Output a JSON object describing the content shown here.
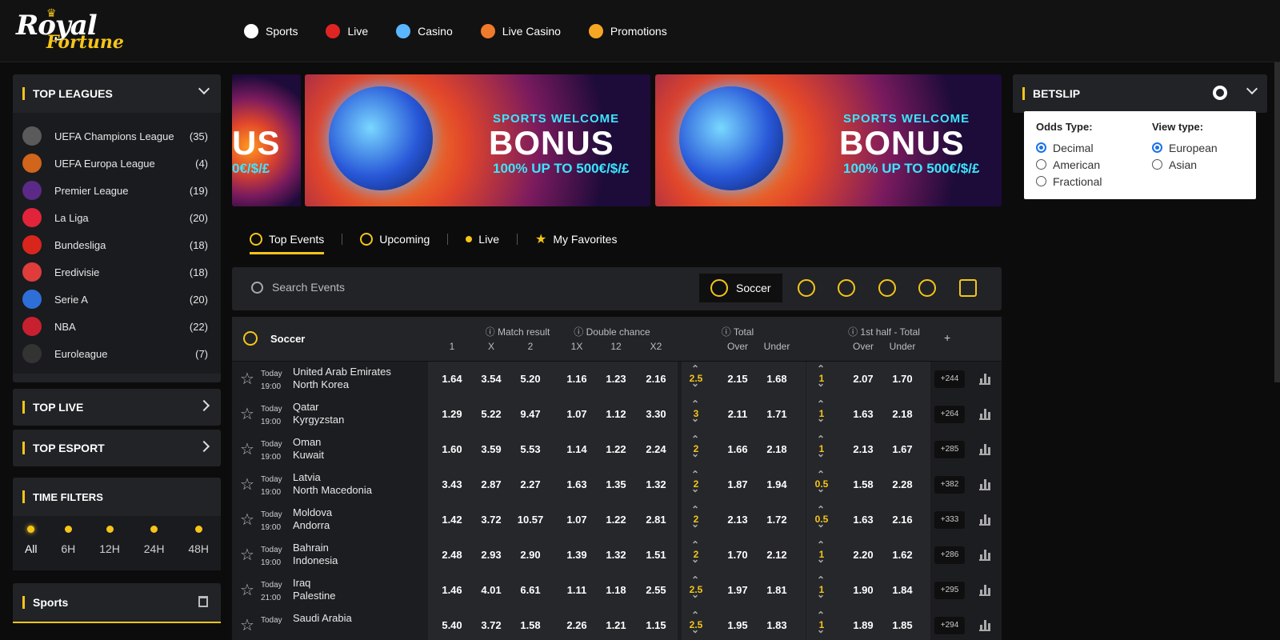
{
  "brand": {
    "line1": "Royal",
    "line2": "Fortune"
  },
  "nav": [
    {
      "label": "Sports",
      "icon": "soccer-ball-icon",
      "color": "#ffffff"
    },
    {
      "label": "Live",
      "icon": "live-play-icon",
      "color": "#e02424"
    },
    {
      "label": "Casino",
      "icon": "diamond-icon",
      "color": "#5ab7ff"
    },
    {
      "label": "Live Casino",
      "icon": "roulette-icon",
      "color": "#f07a2c"
    },
    {
      "label": "Promotions",
      "icon": "gift-icon",
      "color": "#f5a623"
    }
  ],
  "sidebar": {
    "top_leagues_title": "TOP LEAGUES",
    "leagues": [
      {
        "name": "UEFA Champions League",
        "count": "(35)",
        "color": "#5a5a5a"
      },
      {
        "name": "UEFA Europa League",
        "count": "(4)",
        "color": "#d0651b"
      },
      {
        "name": "Premier League",
        "count": "(19)",
        "color": "#5a2a86"
      },
      {
        "name": "La Liga",
        "count": "(20)",
        "color": "#e2243b"
      },
      {
        "name": "Bundesliga",
        "count": "(18)",
        "color": "#d9261c"
      },
      {
        "name": "Eredivisie",
        "count": "(18)",
        "color": "#e03c3c"
      },
      {
        "name": "Serie A",
        "count": "(20)",
        "color": "#2d6fd6"
      },
      {
        "name": "NBA",
        "count": "(22)",
        "color": "#c8202f"
      },
      {
        "name": "Euroleague",
        "count": "(7)",
        "color": "#333333"
      }
    ],
    "top_live": "TOP LIVE",
    "top_esport": "TOP ESPORT",
    "time_filters_title": "TIME FILTERS",
    "time_filters": [
      "All",
      "6H",
      "12H",
      "24H",
      "48H"
    ],
    "sports_title": "Sports"
  },
  "banners": [
    {
      "t1": "SPORTS WELCOME",
      "t2": "BONUS",
      "t3": "100% UP TO 500€/$/£"
    },
    {
      "t1": "SPORTS WELCOME",
      "t2": "BONUS",
      "t3": "100% UP TO 500€/$/£"
    }
  ],
  "banner_fragment": {
    "t2": "US",
    "t3": "0€/$/£"
  },
  "tabs": [
    "Top Events",
    "Upcoming",
    "Live",
    "My Favorites"
  ],
  "search": {
    "placeholder": "Search Events",
    "active_sport": "Soccer"
  },
  "table": {
    "sport": "Soccer",
    "groups": [
      "Match result",
      "Double chance",
      "Total",
      "1st half - Total"
    ],
    "sub_mr": [
      "1",
      "X",
      "2"
    ],
    "sub_dc": [
      "1X",
      "12",
      "X2"
    ],
    "sub_tot": [
      "Over",
      "Under"
    ],
    "plus": "+",
    "rows": [
      {
        "day": "Today",
        "time": "19:00",
        "home": "United Arab Emirates",
        "away": "North Korea",
        "mr": [
          "1.64",
          "3.54",
          "5.20"
        ],
        "dc": [
          "1.16",
          "1.23",
          "2.16"
        ],
        "tl": "2.5",
        "tot": [
          "2.15",
          "1.68"
        ],
        "hl": "1",
        "half": [
          "2.07",
          "1.70"
        ],
        "more": "+244"
      },
      {
        "day": "Today",
        "time": "19:00",
        "home": "Qatar",
        "away": "Kyrgyzstan",
        "mr": [
          "1.29",
          "5.22",
          "9.47"
        ],
        "dc": [
          "1.07",
          "1.12",
          "3.30"
        ],
        "tl": "3",
        "tot": [
          "2.11",
          "1.71"
        ],
        "hl": "1",
        "half": [
          "1.63",
          "2.18"
        ],
        "more": "+264"
      },
      {
        "day": "Today",
        "time": "19:00",
        "home": "Oman",
        "away": "Kuwait",
        "mr": [
          "1.60",
          "3.59",
          "5.53"
        ],
        "dc": [
          "1.14",
          "1.22",
          "2.24"
        ],
        "tl": "2",
        "tot": [
          "1.66",
          "2.18"
        ],
        "hl": "1",
        "half": [
          "2.13",
          "1.67"
        ],
        "more": "+285"
      },
      {
        "day": "Today",
        "time": "19:00",
        "home": "Latvia",
        "away": "North Macedonia",
        "mr": [
          "3.43",
          "2.87",
          "2.27"
        ],
        "dc": [
          "1.63",
          "1.35",
          "1.32"
        ],
        "tl": "2",
        "tot": [
          "1.87",
          "1.94"
        ],
        "hl": "0.5",
        "half": [
          "1.58",
          "2.28"
        ],
        "more": "+382"
      },
      {
        "day": "Today",
        "time": "19:00",
        "home": "Moldova",
        "away": "Andorra",
        "mr": [
          "1.42",
          "3.72",
          "10.57"
        ],
        "dc": [
          "1.07",
          "1.22",
          "2.81"
        ],
        "tl": "2",
        "tot": [
          "2.13",
          "1.72"
        ],
        "hl": "0.5",
        "half": [
          "1.63",
          "2.16"
        ],
        "more": "+333"
      },
      {
        "day": "Today",
        "time": "19:00",
        "home": "Bahrain",
        "away": "Indonesia",
        "mr": [
          "2.48",
          "2.93",
          "2.90"
        ],
        "dc": [
          "1.39",
          "1.32",
          "1.51"
        ],
        "tl": "2",
        "tot": [
          "1.70",
          "2.12"
        ],
        "hl": "1",
        "half": [
          "2.20",
          "1.62"
        ],
        "more": "+286"
      },
      {
        "day": "Today",
        "time": "21:00",
        "home": "Iraq",
        "away": "Palestine",
        "mr": [
          "1.46",
          "4.01",
          "6.61"
        ],
        "dc": [
          "1.11",
          "1.18",
          "2.55"
        ],
        "tl": "2.5",
        "tot": [
          "1.97",
          "1.81"
        ],
        "hl": "1",
        "half": [
          "1.90",
          "1.84"
        ],
        "more": "+295"
      },
      {
        "day": "Today",
        "time": "",
        "home": "Saudi Arabia",
        "away": "",
        "mr": [
          "5.40",
          "3.72",
          "1.58"
        ],
        "dc": [
          "2.26",
          "1.21",
          "1.15"
        ],
        "tl": "2.5",
        "tot": [
          "1.95",
          "1.83"
        ],
        "hl": "1",
        "half": [
          "1.89",
          "1.85"
        ],
        "more": "+294"
      }
    ]
  },
  "betslip": {
    "title": "BETSLIP",
    "odds_type_label": "Odds Type:",
    "odds_types": [
      "Decimal",
      "American",
      "Fractional"
    ],
    "odds_selected": "Decimal",
    "view_type_label": "View type:",
    "view_types": [
      "European",
      "Asian"
    ],
    "view_selected": "European"
  },
  "colors": {
    "accent": "#f5c518",
    "bg": "#0c0c0c",
    "panel": "#222327"
  }
}
